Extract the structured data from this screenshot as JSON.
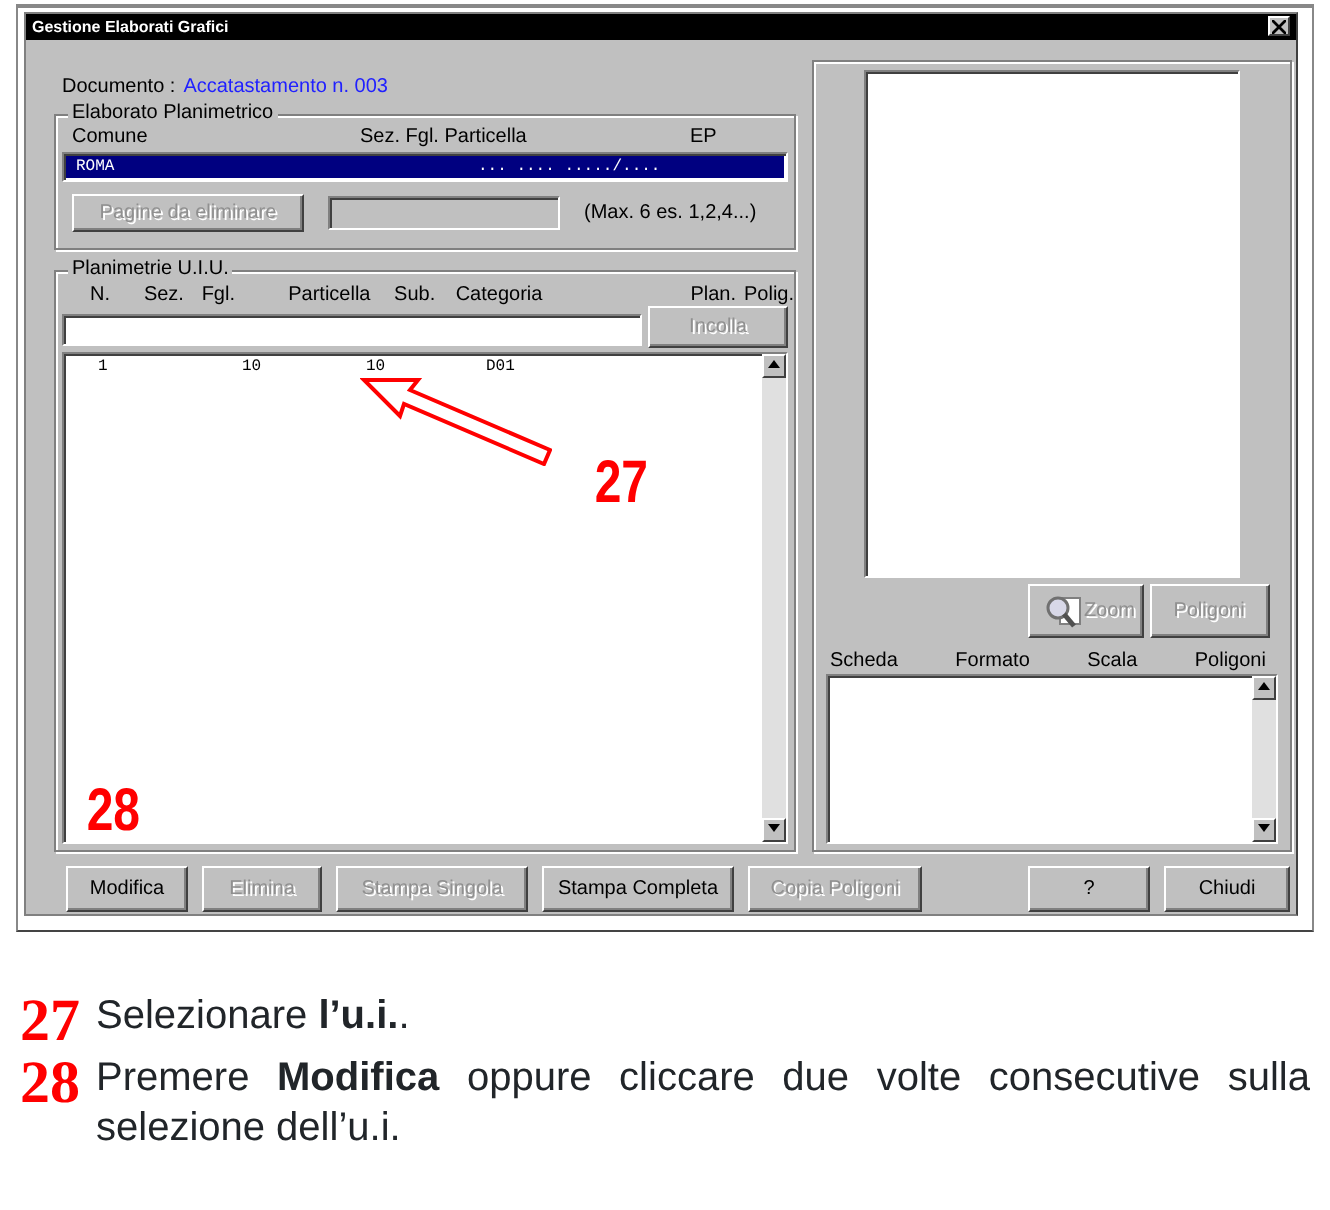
{
  "window": {
    "title": "Gestione Elaborati Grafici"
  },
  "documento": {
    "label": "Documento :",
    "value": "Accatastamento n. 003"
  },
  "elaborato": {
    "title": "Elaborato Planimetrico",
    "columns": [
      "Comune",
      "Sez.  Fgl.  Particella",
      "EP"
    ],
    "rows": [
      {
        "comune": "ROMA",
        "dati": "... .... ...../....",
        "selected": true
      }
    ],
    "pages_button": {
      "label": "Pagine da eliminare",
      "disabled": true
    },
    "hint": "(Max. 6  es. 1,2,4...)"
  },
  "planimetrie": {
    "title": "Planimetrie U.I.U.",
    "columns": [
      "N.",
      "Sez.",
      "Fgl.",
      "Particella",
      "Sub.",
      "Categoria",
      "Plan.",
      "Polig."
    ],
    "paste_button": {
      "label": "Incolla",
      "disabled": true
    },
    "rows": [
      {
        "n": "1",
        "fgl": "10",
        "particella": "10",
        "categoria": "D01",
        "selected": false
      }
    ]
  },
  "annotations": [
    {
      "label": "27",
      "arrow": true
    },
    {
      "label": "28",
      "arrow": false
    }
  ],
  "preview": {
    "buttons": [
      {
        "label": "Zoom",
        "icon": true,
        "disabled": true
      },
      {
        "label": "Poligoni",
        "icon": false,
        "disabled": true
      }
    ],
    "columns": [
      "Scheda",
      "Formato",
      "Scala",
      "Poligoni"
    ]
  },
  "buttons_left": [
    {
      "label": "Modifica",
      "disabled": false
    },
    {
      "label": "Elimina",
      "disabled": true
    },
    {
      "label": "Stampa Singola",
      "disabled": true
    },
    {
      "label": "Stampa Completa",
      "disabled": false
    },
    {
      "label": "Copia Poligoni",
      "disabled": true
    }
  ],
  "buttons_right": [
    {
      "label": "?",
      "disabled": false
    },
    {
      "label": "Chiudi",
      "disabled": false
    }
  ],
  "steps": [
    {
      "number": "27",
      "text": "Selezionare **l’u.i.**."
    },
    {
      "number": "28",
      "text": "Premere **Modifica** oppure cliccare due volte consecutive sulla selezione dell’u.i."
    }
  ]
}
